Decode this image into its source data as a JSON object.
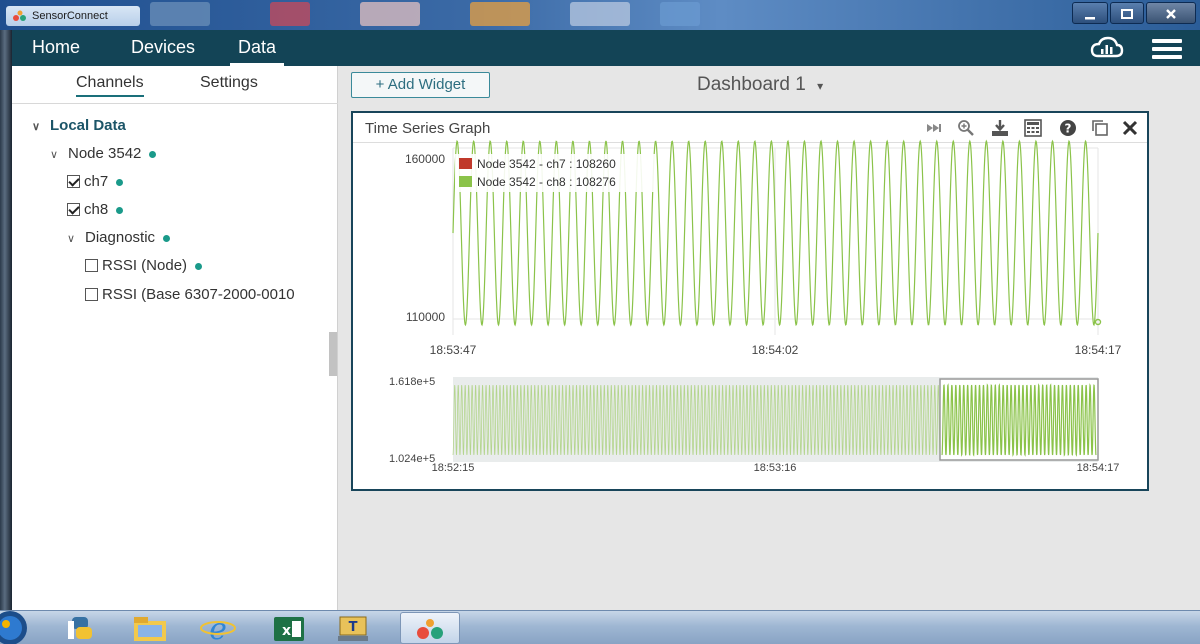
{
  "window": {
    "title": "SensorConnect",
    "minimize_icon": "minimize-icon",
    "maximize_icon": "maximize-icon",
    "close_icon": "close-icon"
  },
  "nav": {
    "items": [
      {
        "label": "Home"
      },
      {
        "label": "Devices"
      },
      {
        "label": "Data",
        "active": true
      }
    ],
    "cloud_icon": "cloud-icon",
    "menu_icon": "hamburger-menu-icon"
  },
  "sidebar": {
    "tabs": [
      {
        "label": "Channels",
        "active": true
      },
      {
        "label": "Settings"
      }
    ],
    "tree": {
      "root": "Local Data",
      "node": "Node 3542",
      "channels": [
        {
          "label": "ch7",
          "checked": true
        },
        {
          "label": "ch8",
          "checked": true
        }
      ],
      "diagnostic": "Diagnostic",
      "diagnostic_channels": [
        {
          "label": "RSSI (Node)",
          "checked": false
        },
        {
          "label": "RSSI (Base 6307-2000-0010",
          "checked": false
        }
      ]
    }
  },
  "toolbar": {
    "add_widget_label": "+ Add Widget",
    "dashboard_title": "Dashboard 1"
  },
  "widget": {
    "title": "Time Series Graph",
    "icons": [
      "skip-to-end-icon",
      "zoom-in-icon",
      "download-icon",
      "calculator-icon",
      "help-icon",
      "duplicate-icon",
      "close-icon"
    ],
    "colors": {
      "ch7": "#c0392b",
      "ch8": "#8bc34a",
      "border": "#18455a"
    }
  },
  "taskbar": {
    "icons": [
      "start-orb-icon",
      "python-icon",
      "file-explorer-icon",
      "internet-explorer-icon",
      "excel-icon",
      "teraterm-icon",
      "sensorconnect-icon"
    ]
  },
  "chart_data": [
    {
      "type": "line",
      "legend_placement": "top-left",
      "series": [
        {
          "name": "Node 3542 - ch7 : 108260",
          "color": "#c0392b",
          "values": []
        },
        {
          "name": "Node 3542 - ch8 : 108276",
          "color": "#8bc34a",
          "oscillation": {
            "min": 108260,
            "max": 162000,
            "cycles": 39
          }
        }
      ],
      "x_ticks": [
        "18:53:47",
        "18:54:02",
        "18:54:17"
      ],
      "y_ticks": [
        "160000",
        "110000"
      ],
      "xlim": [
        "18:53:47",
        "18:54:17"
      ],
      "grid": true
    },
    {
      "type": "area",
      "x_ticks": [
        "18:52:15",
        "18:53:16",
        "18:54:17"
      ],
      "y_ticks": [
        "1.618e+5",
        "1.024e+5"
      ],
      "xlim": [
        "18:52:15",
        "18:54:17"
      ],
      "ylim": [
        102400,
        161800
      ],
      "selection_range": [
        "18:53:47",
        "18:54:17"
      ]
    }
  ]
}
